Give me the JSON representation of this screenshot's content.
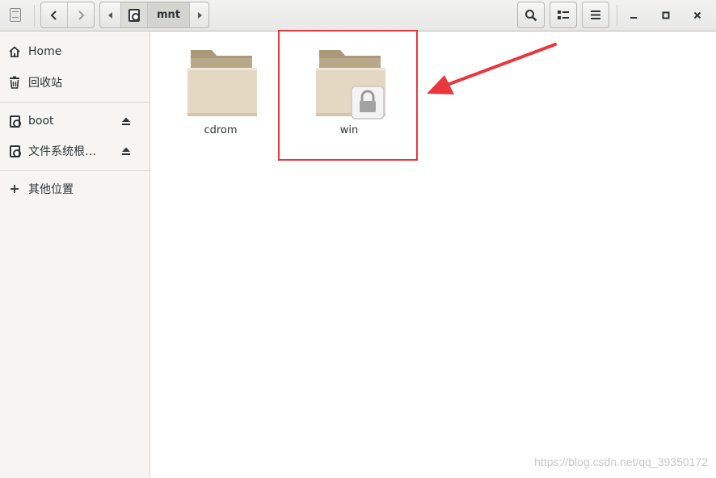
{
  "window": {
    "path_segments": [
      "mnt"
    ],
    "controls": {
      "minimize": "–",
      "maximize": "□",
      "close": "×"
    }
  },
  "sidebar": {
    "items": [
      {
        "label": "Home",
        "icon": "home-icon"
      },
      {
        "label": "回收站",
        "icon": "trash-icon"
      },
      {
        "label": "boot",
        "icon": "drive-icon",
        "eject": true
      },
      {
        "label": "文件系统根…",
        "icon": "drive-icon",
        "eject": true
      },
      {
        "label": "其他位置",
        "icon": "plus-icon"
      }
    ]
  },
  "files": [
    {
      "name": "cdrom",
      "locked": false
    },
    {
      "name": "win",
      "locked": true
    }
  ],
  "annotation": {
    "color": "#e8383d"
  },
  "watermark": "https://blog.csdn.net/qq_39350172",
  "colors": {
    "folder_back": "#bfae8e",
    "folder_front": "#e3d6c0",
    "sidebar_bg": "#f6f5f4",
    "header_bg": "#ececeb"
  }
}
